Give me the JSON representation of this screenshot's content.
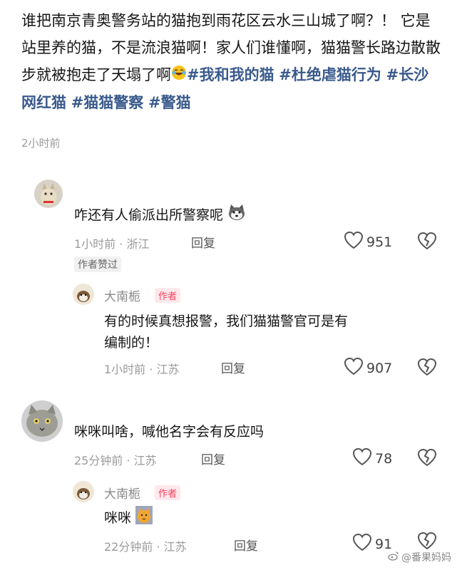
{
  "post": {
    "text": "谁把南京青奥警务站的猫抱到雨花区云水三山城了啊？！ 它是站里养的猫，不是流浪猫啊！家人们谁懂啊，猫猫警长路边散散步就被抱走了天塌了啊",
    "tags": [
      "#我和我的猫",
      "#杜绝虐猫行为",
      "#长沙网红猫",
      "#猫猫警察",
      "#警猫"
    ],
    "time": "2小时前"
  },
  "comments": [
    {
      "text": "咋还有人偷派出所警察呢",
      "meta": "1小时前 · 浙江",
      "reply_label": "回复",
      "likes": "951",
      "badge": "作者赞过",
      "reply": {
        "name": "大南栀",
        "author_label": "作者",
        "text_line1": "有的时候真想报警，我们猫猫警官可是有",
        "text_line2": "编制的！",
        "meta": "1小时前 · 江苏",
        "reply_label": "回复",
        "likes": "907"
      }
    },
    {
      "text": "咪咪叫啥，喊他名字会有反应吗",
      "meta": "25分钟前 · 江苏",
      "reply_label": "回复",
      "likes": "78",
      "reply": {
        "name": "大南栀",
        "author_label": "作者",
        "text": "咪咪",
        "meta": "22分钟前 · 江苏",
        "reply_label": "回复",
        "likes": "91"
      }
    }
  ],
  "watermark": "@番果妈妈",
  "colors": {
    "tag": "#3a5a8c",
    "author_tag": "#ff3d5a"
  }
}
